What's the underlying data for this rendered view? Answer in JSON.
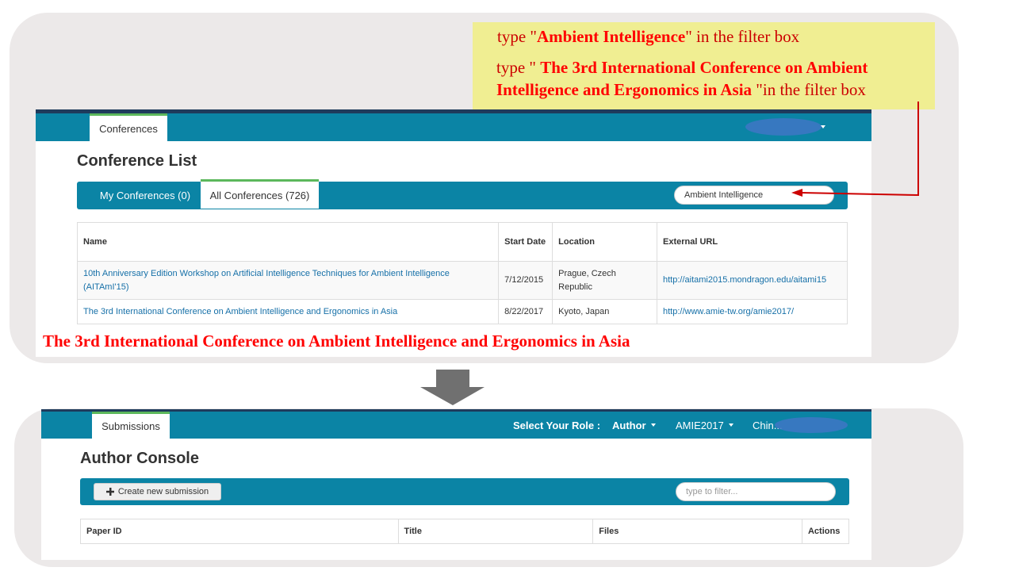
{
  "annotation": {
    "line1_pre": "type \"",
    "line1_highlight": "Ambient Intelligence",
    "line1_post": "\" in the filter box",
    "line2_pre": "type \" ",
    "line2_highlight": "The 3rd International Conference on Ambient",
    "line3_highlight": "Intelligence and Ergonomics in Asia",
    "line3_post": " \"in the filter box"
  },
  "caption": "The 3rd International Conference on Ambient Intelligence and Ergonomics in Asia",
  "conference_screen": {
    "nav_tab": "Conferences",
    "title": "Conference List",
    "tabs": [
      {
        "label": "My Conferences (0)"
      },
      {
        "label": "All Conferences (726)"
      }
    ],
    "filter_value": "Ambient Intelligence",
    "columns": [
      "Name",
      "Start Date",
      "Location",
      "External URL"
    ],
    "rows": [
      {
        "name": "10th Anniversary Edition Workshop on Artificial Intelligence Techniques for Ambient Intelligence (AITAmI'15)",
        "start_date": "7/12/2015",
        "location": "Prague, Czech Republic",
        "url": "http://aitami2015.mondragon.edu/aitami15"
      },
      {
        "name": "The 3rd International Conference on Ambient Intelligence and Ergonomics in Asia",
        "start_date": "8/22/2017",
        "location": "Kyoto, Japan",
        "url": "http://www.amie-tw.org/amie2017/"
      }
    ]
  },
  "author_screen": {
    "nav_tab": "Submissions",
    "role_label": "Select Your Role :",
    "role_value": "Author",
    "conference_value": "AMIE2017",
    "user_value": "Chin...",
    "title": "Author Console",
    "create_button": "Create new submission",
    "filter_placeholder": "type to filter...",
    "columns": [
      "Paper ID",
      "Title",
      "Files",
      "Actions"
    ]
  },
  "colors": {
    "navbar": "#0b84a5",
    "navbar_top_border": "#1f3b5c",
    "active_tab_border": "#5cb85c",
    "annotation_bg": "#f0ee92",
    "annotation_text": "#cc0000",
    "arrow": "#cc0000",
    "down_arrow": "#707070",
    "link": "#1670a8"
  },
  "icons": {
    "dropdown": "caret-down-icon",
    "create": "plus-icon",
    "flow": "down-arrow-icon",
    "pointer": "pointer-arrow-icon"
  }
}
